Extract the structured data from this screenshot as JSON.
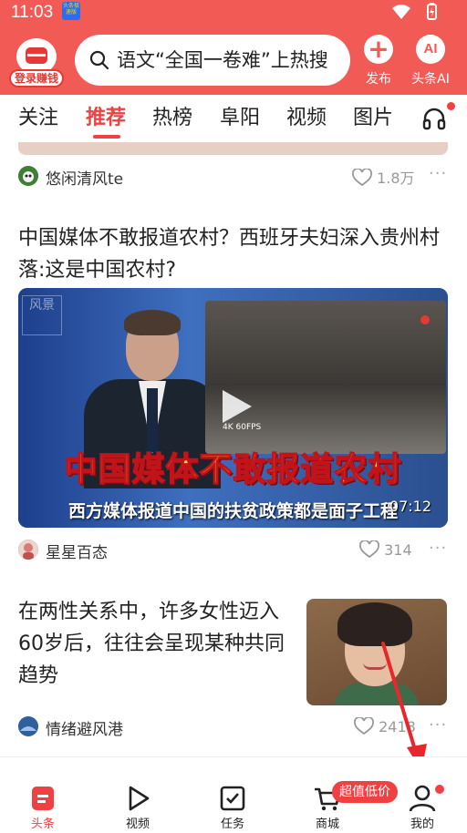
{
  "status_bar": {
    "time": "11:03",
    "notif_text": "头条极速版"
  },
  "header": {
    "login_label": "登录赚钱",
    "search_text": "语文“全国一卷难”上热搜",
    "publish_label": "发布",
    "publish_glyph": "+",
    "ai_label": "头条AI",
    "ai_glyph": "AI"
  },
  "tabs": [
    {
      "label": "关注"
    },
    {
      "label": "推荐"
    },
    {
      "label": "热榜"
    },
    {
      "label": "阜阳"
    },
    {
      "label": "视频"
    },
    {
      "label": "图片"
    }
  ],
  "feed": {
    "item0": {
      "author": "悠闲清风te",
      "likes": "1.8万",
      "more": "···"
    },
    "item1": {
      "title": "中国媒体不敢报道农村？西班牙夫妇深入贵州村落:这是中国农村?",
      "video_caption_big": "中国媒体不敢报道农村",
      "video_caption_small": "西方媒体报道中国的扶贫政策都是面子工程",
      "video_fps": "4K  60FPS",
      "video_logo": "风景",
      "duration": "07:12",
      "author": "星星百态",
      "likes": "314",
      "more": "···"
    },
    "item2": {
      "title": "在两性关系中，许多女性迈入60岁后，往往会呈现某种共同趋势",
      "author": "情绪避风港",
      "likes": "2418",
      "more": "···"
    }
  },
  "bottom_nav": {
    "items": [
      {
        "label": "头条"
      },
      {
        "label": "视频"
      },
      {
        "label": "任务"
      },
      {
        "label": "商城"
      },
      {
        "label": "我的"
      }
    ],
    "deal_badge": "超值低价"
  },
  "colors": {
    "brand_red": "#f25a55",
    "active_red": "#f04142"
  }
}
